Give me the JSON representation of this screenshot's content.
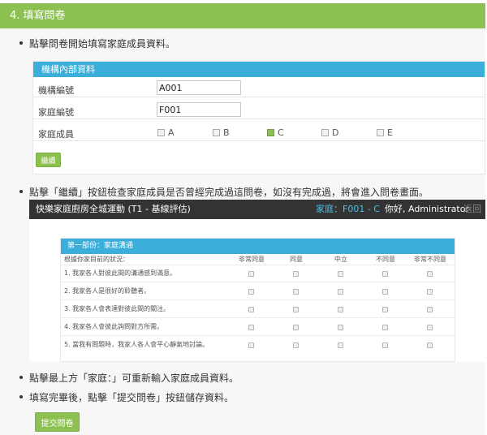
{
  "section": {
    "title": "4. 填寫問卷"
  },
  "bullets": {
    "b1": "點擊問卷開始填寫家庭成員資料。",
    "b2": "點擊「繼續」按鈕檢查家庭成員是否曾經完成過這問卷，如沒有完成過，將會進入問卷畫面。",
    "b3": "點擊最上方「家庭：」可重新輸入家庭成員資料。",
    "b4": "填寫完畢後，點擊「提交問卷」按鈕儲存資料。"
  },
  "form": {
    "panel_title": "機構內部資料",
    "org_label": "機構編號",
    "org_value": "A001",
    "family_label": "家庭編號",
    "family_value": "F001",
    "members_label": "家庭成員",
    "members": [
      {
        "label": "A",
        "checked": false
      },
      {
        "label": "B",
        "checked": false
      },
      {
        "label": "C",
        "checked": true
      },
      {
        "label": "D",
        "checked": false
      },
      {
        "label": "E",
        "checked": false
      }
    ],
    "continue_label": "繼續"
  },
  "survey": {
    "title": "快樂家庭廚房全城運動 (T1 - 基線評估)",
    "family_link": "家庭：F001 - C",
    "greeting": "你好, Administrator",
    "back": "返回",
    "part_title": "第一部份：家庭溝通",
    "prompt": "根據你家目前的狀況：",
    "scale": [
      "非常同意",
      "同意",
      "中立",
      "不同意",
      "非常不同意"
    ],
    "questions": [
      "1. 我家各人對彼此間的溝通感到滿意。",
      "2. 我家各人是很好的聆聽者。",
      "3. 我家各人會表達對彼此間的關注。",
      "4. 我家各人會彼此詢問對方所需。",
      "5. 當我有問題時，我家人各人會平心靜氣地討論。"
    ]
  },
  "submit": {
    "label": "提交問卷"
  },
  "colors": {
    "green": "#8cc152",
    "blue": "#3bafda",
    "dark": "#333333"
  }
}
